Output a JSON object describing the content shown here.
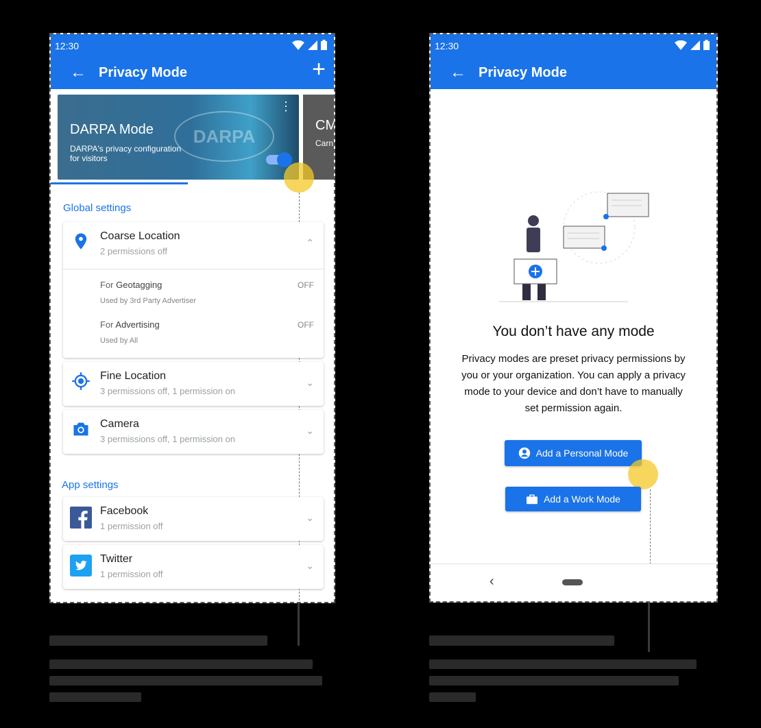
{
  "left_screen": {
    "status_time": "12:30",
    "title": "Privacy Mode",
    "modes": [
      {
        "name": "DARPA Mode",
        "description": "DARPA's privacy configuration for visitors",
        "logo_text": "DARPA"
      },
      {
        "name": "CM",
        "description": "Carn reco facul"
      }
    ],
    "global_settings_label": "Global settings",
    "coarse_location": {
      "title": "Coarse Location",
      "subtitle": "2 permissions off",
      "items": [
        {
          "prefix": "For ",
          "name": "Geotagging",
          "desc": "Used by 3rd Party Advertiser",
          "state": "OFF"
        },
        {
          "prefix": "For ",
          "name": "Advertising",
          "desc": "Used by All",
          "state": "OFF"
        }
      ]
    },
    "fine_location": {
      "title": "Fine Location",
      "subtitle": "3 permissions off, 1 permission on"
    },
    "camera": {
      "title": "Camera",
      "subtitle": "3 permissions off, 1 permission on"
    },
    "app_settings_label": "App settings",
    "facebook": {
      "title": "Facebook",
      "subtitle": "1 permission off"
    },
    "twitter": {
      "title": "Twitter",
      "subtitle": "1 permission off"
    }
  },
  "right_screen": {
    "status_time": "12:30",
    "title": "Privacy Mode",
    "heading": "You don’t have any mode",
    "body": "Privacy modes are preset privacy permissions by you or your organization. You can apply a privacy mode to your device and don’t have to manually set permission again.",
    "add_personal_label": "Add a Personal Mode",
    "add_work_label": "Add a Work Mode"
  },
  "colors": {
    "primary": "#1a73e8",
    "touch_indicator": "#f4c828"
  }
}
